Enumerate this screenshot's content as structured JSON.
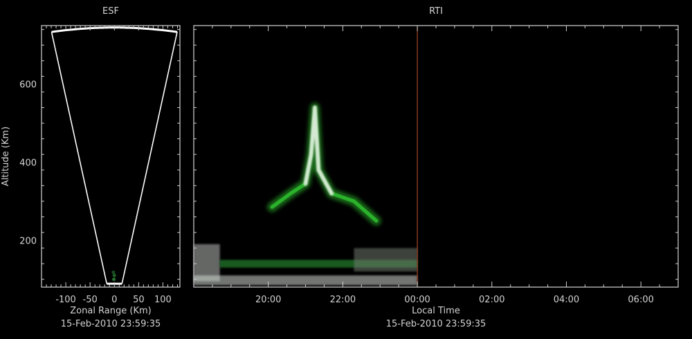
{
  "chart_data": [
    {
      "type": "scatter",
      "title": "ESF",
      "xlabel": "Zonal Range (Km)",
      "ylabel": "Altitude (Km)",
      "timestamp": "15-Feb-2010 23:59:35",
      "xlim": [
        -150,
        135
      ],
      "ylim": [
        80,
        750
      ],
      "x_ticks": [
        -100,
        -50,
        0,
        50,
        100
      ],
      "x_tick_labels": [
        "-100",
        "-50",
        "0",
        "50",
        "100"
      ],
      "y_ticks": [
        200,
        400,
        600
      ],
      "y_tick_labels": [
        "200",
        "400",
        "600"
      ],
      "beam_sector": {
        "range_min_km": 90,
        "range_max_km": 745,
        "half_angle_deg": 10
      },
      "echo_points": [
        {
          "x": -1,
          "y": 100,
          "intensity": 0.6
        },
        {
          "x": 0,
          "y": 110,
          "intensity": 0.5
        },
        {
          "x": -2,
          "y": 118,
          "intensity": 0.4
        }
      ]
    },
    {
      "type": "heatmap",
      "title": "RTI",
      "xlabel": "Local Time",
      "timestamp": "15-Feb-2010 23:59:35",
      "xlim": [
        18.0,
        31.0
      ],
      "ylim": [
        80,
        750
      ],
      "x_ticks": [
        20,
        22,
        24,
        26,
        28,
        30
      ],
      "x_tick_labels": [
        "20:00",
        "22:00",
        "00:00",
        "02:00",
        "04:00",
        "06:00"
      ],
      "y_ticks": [
        200,
        400,
        600
      ],
      "current_time": 24.0,
      "current_time_color": "#a64a2a",
      "echo_color": "#2fbf2f",
      "plume_color": "#e8efe6",
      "background_color": "#000000",
      "plume_spine": [
        {
          "t": 20.1,
          "alt": 285
        },
        {
          "t": 20.6,
          "alt": 320
        },
        {
          "t": 21.0,
          "alt": 345
        },
        {
          "t": 21.15,
          "alt": 420
        },
        {
          "t": 21.25,
          "alt": 540
        },
        {
          "t": 21.35,
          "alt": 380
        },
        {
          "t": 21.7,
          "alt": 320
        },
        {
          "t": 22.3,
          "alt": 300
        },
        {
          "t": 22.9,
          "alt": 250
        }
      ],
      "bottom_layers": [
        {
          "t_start": 18.0,
          "t_end": 18.7,
          "alt_min": 95,
          "alt_max": 190,
          "color": "#b9bcb9"
        },
        {
          "t_start": 18.7,
          "t_end": 24.0,
          "alt_min": 130,
          "alt_max": 150,
          "color": "#2fa43a"
        },
        {
          "t_start": 18.0,
          "t_end": 24.0,
          "alt_min": 85,
          "alt_max": 110,
          "color": "#cfd6cf"
        },
        {
          "t_start": 22.3,
          "t_end": 24.0,
          "alt_min": 120,
          "alt_max": 180,
          "color": "#6f7a6e"
        }
      ]
    }
  ]
}
